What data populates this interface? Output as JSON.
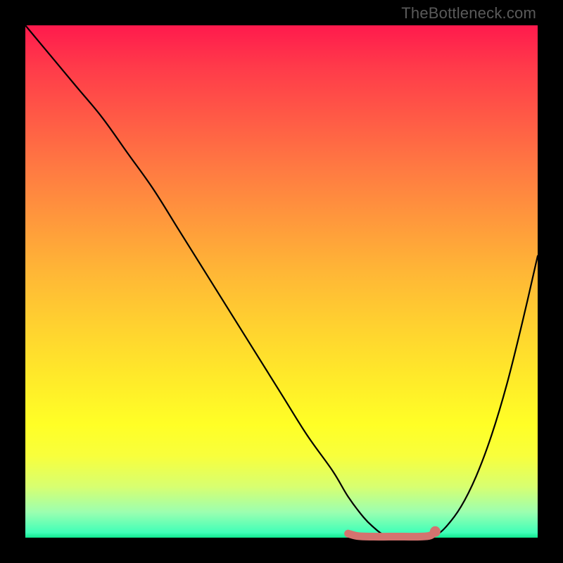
{
  "watermark": "TheBottleneck.com",
  "chart_data": {
    "type": "line",
    "title": "",
    "xlabel": "",
    "ylabel": "",
    "xlim": [
      0,
      100
    ],
    "ylim": [
      0,
      100
    ],
    "grid": false,
    "legend": false,
    "series": [
      {
        "name": "bottleneck-curve",
        "x": [
          0,
          5,
          10,
          15,
          20,
          25,
          30,
          35,
          40,
          45,
          50,
          55,
          60,
          63,
          66,
          68,
          70,
          72,
          74,
          78,
          80,
          82,
          85,
          88,
          91,
          94,
          97,
          100
        ],
        "values": [
          100,
          94,
          88,
          82,
          75,
          68,
          60,
          52,
          44,
          36,
          28,
          20,
          13,
          8,
          4,
          2,
          0.5,
          0.2,
          0.2,
          0.2,
          0.5,
          2,
          6,
          12,
          20,
          30,
          42,
          55
        ]
      },
      {
        "name": "optimal-range-marker",
        "x": [
          63,
          65,
          68,
          71,
          74,
          77,
          79,
          80
        ],
        "values": [
          0.8,
          0.3,
          0.2,
          0.2,
          0.2,
          0.2,
          0.4,
          1.2
        ]
      }
    ],
    "annotations": [
      {
        "type": "endpoint-dot",
        "series": "optimal-range-marker",
        "end": "right"
      }
    ],
    "colors": {
      "curve": "#000000",
      "marker": "#d4736f",
      "gradient_top": "#ff1a4d",
      "gradient_bottom": "#10e890"
    }
  }
}
